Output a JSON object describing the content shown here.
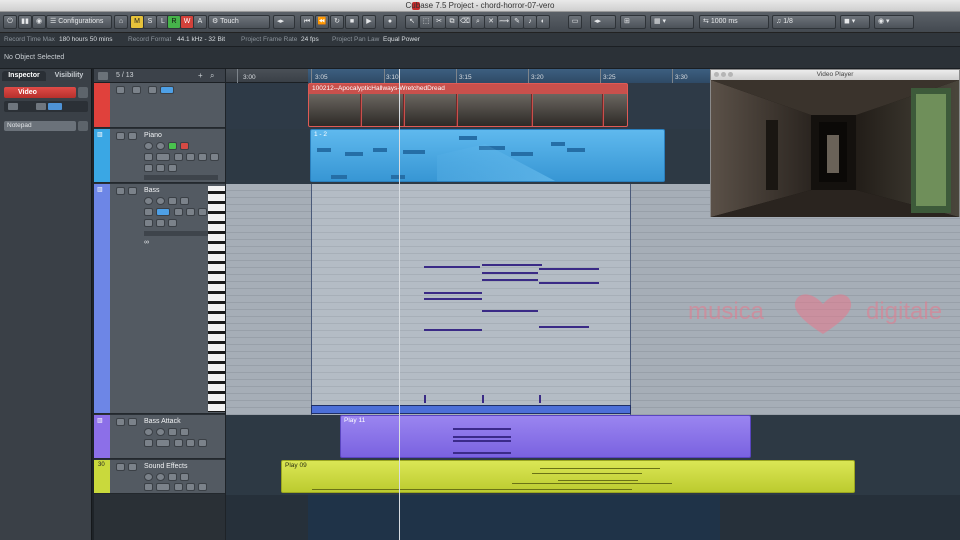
{
  "window": {
    "title": "Cubase 7.5 Project - chord-horror-07-vero"
  },
  "toolbar": {
    "configurations": "Configurations",
    "automation_mode": "Touch",
    "m": "M",
    "s": "S",
    "l": "L",
    "r": "R",
    "w": "W",
    "a": "A",
    "nudge": "1000 ms",
    "quantize": "1/8"
  },
  "statusbar": {
    "record_time_max_label": "Record Time Max",
    "record_time_max": "180 hours 50 mins",
    "record_format_label": "Record Format",
    "record_format": "44.1 kHz - 32 Bit",
    "frame_rate_label": "Project Frame Rate",
    "frame_rate": "24 fps",
    "pan_law_label": "Project Pan Law",
    "pan_law": "Equal Power"
  },
  "infoline": {
    "text": "No Object Selected"
  },
  "inspector": {
    "tabs": [
      "Inspector",
      "Visibility"
    ],
    "track_name": "Video",
    "notepad": "Notepad"
  },
  "tracklist": {
    "count": "5 / 13",
    "tracks": [
      {
        "name": "",
        "color": "#e0413c"
      },
      {
        "name": "Piano",
        "color": "#3aa7e4"
      },
      {
        "name": "Bass",
        "color": "#6d86e6"
      },
      {
        "name": "Bass Attack",
        "color": "#8c6fe8"
      },
      {
        "name": "Sound Effects",
        "color": "#c9d93c",
        "number": "30"
      }
    ]
  },
  "ruler": {
    "ticks": [
      "3:00",
      "3:05",
      "3:10",
      "3:15",
      "3:20",
      "3:25",
      "3:30"
    ]
  },
  "parts": {
    "video": "100212--ApocalypticHallways-WretchedDread",
    "piano": "1 - 2",
    "bass_attack": "Play 11",
    "sound_effects": "Play 09"
  },
  "video_player": {
    "title": "Video Player"
  },
  "watermark": {
    "left": "musica",
    "right": "digitale"
  },
  "colors": {
    "video_track": "#e0413c",
    "piano_part": "#3aa7e4",
    "bass_part": "#5a7ae0",
    "bass_attack_part": "#8a74ea",
    "sound_effects_part": "#cfdc3a"
  }
}
